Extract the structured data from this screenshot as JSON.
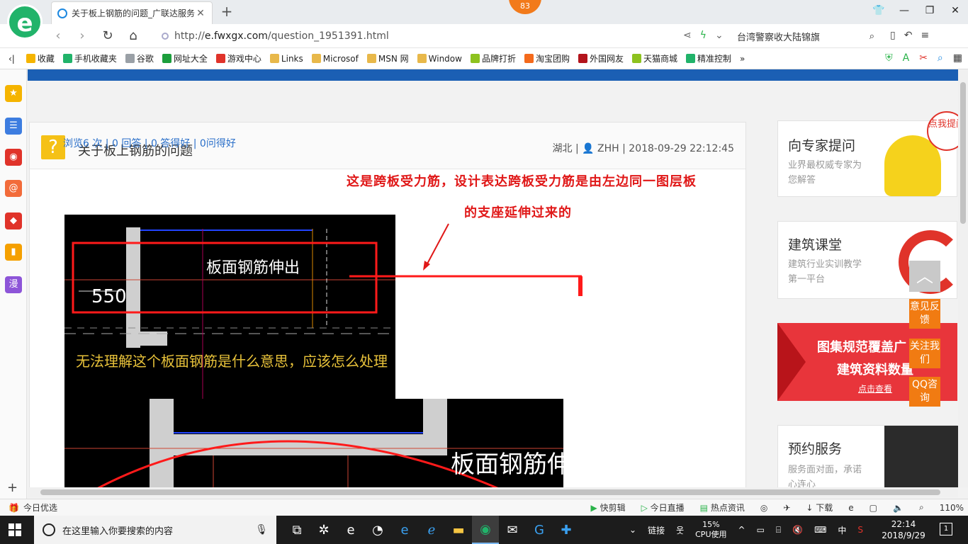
{
  "browser": {
    "tab_title": "关于板上钢筋的问题_广联达服务",
    "badge_count": "83",
    "url_prefix": "http://",
    "url_domain": "e.fwxgx.com",
    "url_path": "/question_1951391.html",
    "search_text": "台湾警察收大陆锦旗"
  },
  "bookmarks": [
    {
      "label": "收藏",
      "color": "#f5b400"
    },
    {
      "label": "手机收藏夹",
      "color": "#21b36a"
    },
    {
      "label": "谷歌",
      "color": "#9aa0a6"
    },
    {
      "label": "网址大全",
      "color": "#1c9e3c"
    },
    {
      "label": "游戏中心",
      "color": "#e0332a"
    },
    {
      "label": "Links",
      "color": "#e8b84a"
    },
    {
      "label": "Microsof",
      "color": "#e8b84a"
    },
    {
      "label": "MSN 网",
      "color": "#e8b84a"
    },
    {
      "label": "Window",
      "color": "#e8b84a"
    },
    {
      "label": "品牌打折",
      "color": "#8dc21f"
    },
    {
      "label": "淘宝团购",
      "color": "#f46a1c"
    },
    {
      "label": "外国网友",
      "color": "#b3141c"
    },
    {
      "label": "天猫商城",
      "color": "#8dc21f"
    },
    {
      "label": "精准控制",
      "color": "#21b36a"
    }
  ],
  "sidebar_icons": [
    {
      "name": "star-icon",
      "glyph": "★",
      "color": "#f5b400"
    },
    {
      "name": "news-icon",
      "glyph": "☰",
      "color": "#3d7de0"
    },
    {
      "name": "weibo-icon",
      "glyph": "◉",
      "color": "#e0332a"
    },
    {
      "name": "mail-icon",
      "glyph": "@",
      "color": "#f26b3a"
    },
    {
      "name": "game-icon",
      "glyph": "◆",
      "color": "#e0332a"
    },
    {
      "name": "book-icon",
      "glyph": "▮",
      "color": "#f5a000"
    },
    {
      "name": "manga-icon",
      "glyph": "漫",
      "color": "#8d55d8"
    }
  ],
  "question": {
    "title": "关于板上钢筋的问题",
    "region": "湖北",
    "user": "ZHH",
    "datetime": "2018-09-29 22:12:45",
    "stats": "浏览6 次 | 0 回答 | 0 答得好 | 0问得好",
    "annotation_line1": "这是跨板受力筋，设计表达跨板受力筋是由左边同一图层板",
    "annotation_line2": "的支座延伸过来的",
    "image1_label": "板面钢筋伸出",
    "image1_dim": "550",
    "image1_caption": "无法理解这个板面钢筋是什么意思，应该怎么处理",
    "image2_label": "板面钢筋伸出"
  },
  "side_cards": {
    "expert_title": "向专家提问",
    "expert_sub": "业界最权威专家为您解答",
    "expert_bubble": "点我提问",
    "class_title": "建筑课堂",
    "class_sub": "建筑行业实训教学第一平台",
    "banner_line1": "图集规范覆盖广",
    "banner_line2": "建筑资料数量",
    "banner_link": "点击查看",
    "service_title": "预约服务",
    "service_sub": "服务面对面，承诺心连心"
  },
  "float_buttons": {
    "feedback": "意见反馈",
    "follow": "关注我们",
    "qq": "QQ咨询"
  },
  "statusbar": {
    "left": "今日优选",
    "items": [
      "快剪辑",
      "今日直播",
      "热点资讯",
      "下载",
      "110%"
    ]
  },
  "taskbar": {
    "search_placeholder": "在这里输入你要搜索的内容",
    "tray_link": "链接",
    "cpu_percent": "15%",
    "cpu_label": "CPU使用",
    "ime": "中",
    "time": "22:14",
    "date": "2018/9/29",
    "notif_count": "1"
  }
}
